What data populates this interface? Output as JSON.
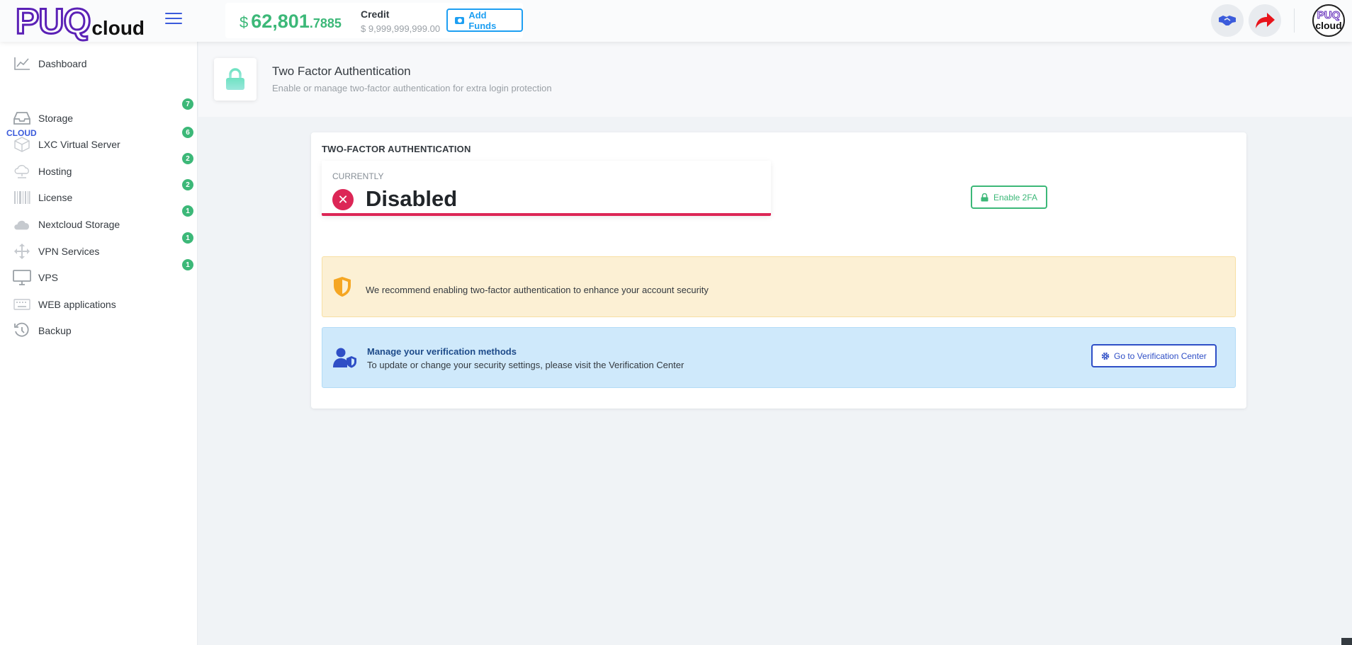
{
  "header": {
    "logo": {
      "primary": "PUQ",
      "secondary": "cloud"
    },
    "balance": {
      "currency": "$",
      "main": "62,801",
      "decimals": ".7885"
    },
    "credit": {
      "label": "Credit",
      "value": "$ 9,999,999,999.00"
    },
    "add_funds_label": "Add Funds",
    "avatar": {
      "line1": "PUQ",
      "line2": "cloud"
    }
  },
  "sidebar": {
    "dashboard_label": "Dashboard",
    "section_label": "CLOUD",
    "items": [
      {
        "label": "Storage",
        "badge": "7",
        "icon": "inbox-icon"
      },
      {
        "label": "LXC Virtual Server",
        "badge": "6",
        "icon": "box-icon"
      },
      {
        "label": "Hosting",
        "badge": "2",
        "icon": "cloud-network-icon"
      },
      {
        "label": "License",
        "badge": "2",
        "icon": "barcode-icon"
      },
      {
        "label": "Nextcloud Storage",
        "badge": "1",
        "icon": "cloud-icon"
      },
      {
        "label": "VPN Services",
        "badge": "1",
        "icon": "move-arrows-icon"
      },
      {
        "label": "VPS",
        "badge": "1",
        "icon": "monitor-icon"
      },
      {
        "label": "WEB applications",
        "badge": "",
        "icon": "keyboard-icon"
      },
      {
        "label": "Backup",
        "badge": "",
        "icon": "history-icon"
      }
    ]
  },
  "page": {
    "title": "Two Factor Authentication",
    "subtitle": "Enable or manage two-factor authentication for extra login protection"
  },
  "card": {
    "title": "TWO-FACTOR AUTHENTICATION",
    "status_caption": "CURRENTLY",
    "status_value": "Disabled",
    "enable_button": "Enable 2FA",
    "warning_text": "We recommend enabling two-factor authentication to enhance your account security",
    "info_title": "Manage your verification methods",
    "info_text": "To update or change your security settings, please visit the Verification Center",
    "verification_button": "Go to Verification Center"
  },
  "colors": {
    "brand": "#5b21b6",
    "accent_blue": "#1e9ff2",
    "success": "#3cb878",
    "danger": "#dc2656",
    "warning_bg": "#fcf0d4",
    "info_bg": "#cfe9fb"
  }
}
